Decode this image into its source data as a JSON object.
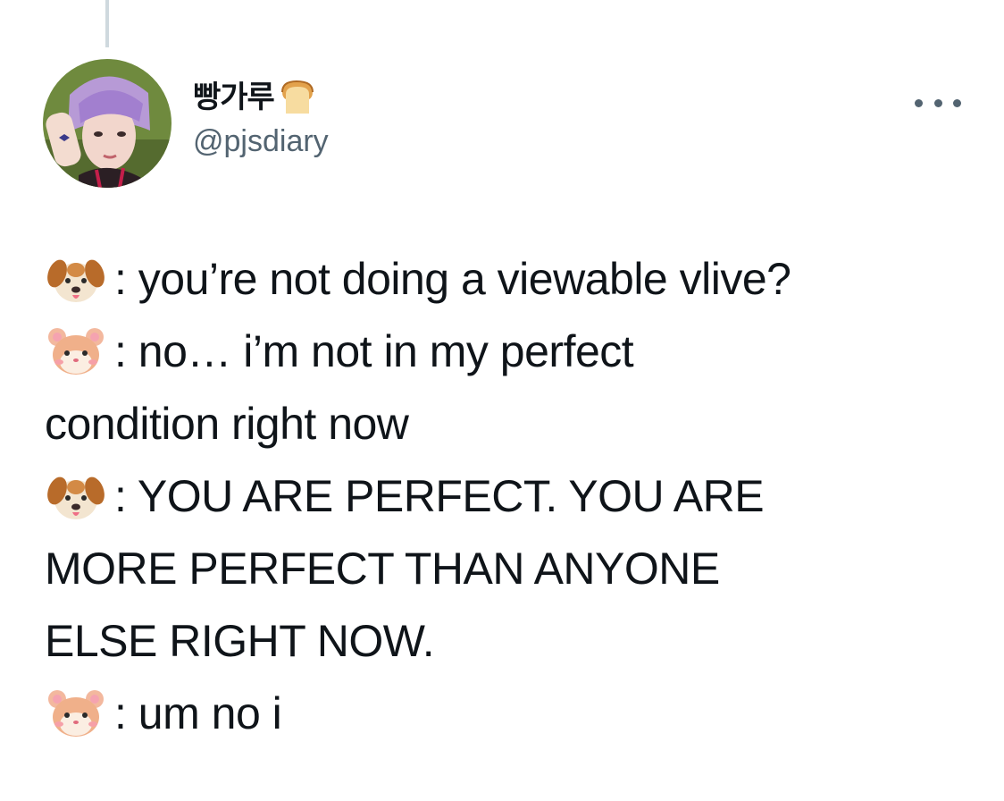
{
  "tweet": {
    "author": {
      "display_name": "빵가루",
      "name_icon": "bread-icon",
      "handle": "@pjsdiary"
    },
    "more_icon": "more-icon",
    "lines": [
      {
        "icon": "dog-face-icon",
        "text": ": you’re not doing a viewable vlive?"
      },
      {
        "icon": "hamster-face-icon",
        "text": ": no… i’m not in my perfect"
      },
      {
        "icon": "",
        "text": "condition right now"
      },
      {
        "icon": "dog-face-icon",
        "text": ": YOU ARE PERFECT. YOU ARE"
      },
      {
        "icon": "",
        "text": "MORE PERFECT THAN ANYONE"
      },
      {
        "icon": "",
        "text": "ELSE RIGHT NOW."
      },
      {
        "icon": "hamster-face-icon",
        "text": ": um no i"
      }
    ]
  }
}
